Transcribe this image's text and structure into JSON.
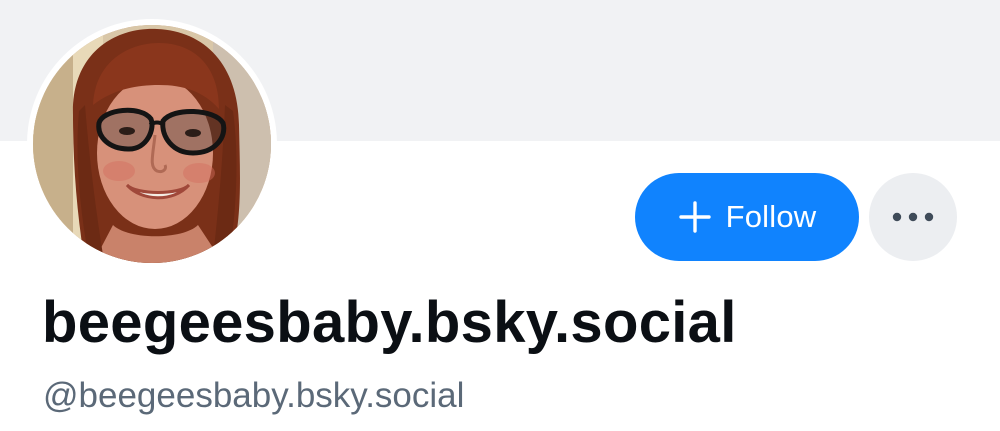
{
  "profile": {
    "display_name": "beegeesbaby.bsky.social",
    "handle": "@beegeesbaby.bsky.social"
  },
  "actions": {
    "follow_label": "Follow",
    "follow_icon": "plus-icon",
    "more_icon": "ellipsis-icon"
  },
  "colors": {
    "banner": "#f1f2f4",
    "follow_button": "#1083fe",
    "more_button": "#eceef1",
    "display_name": "#0b0f14",
    "handle": "#5b6978"
  }
}
